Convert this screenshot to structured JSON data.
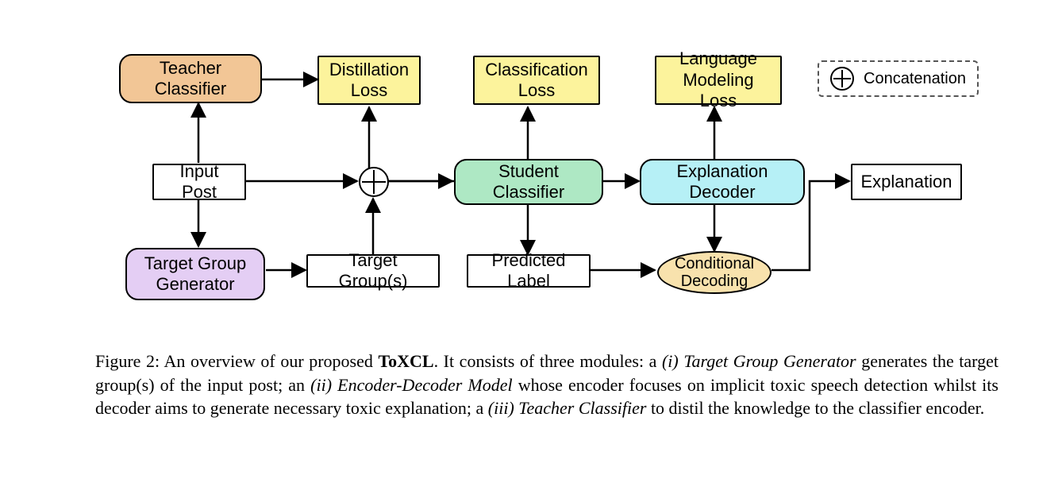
{
  "nodes": {
    "teacher": "Teacher Classifier",
    "distill_loss": "Distillation Loss",
    "class_loss": "Classification Loss",
    "lm_loss": "Language Modeling Loss",
    "input_post": "Input Post",
    "student": "Student Classifier",
    "decoder": "Explanation Decoder",
    "explanation": "Explanation",
    "tg_generator": "Target Group Generator",
    "target_groups": "Target Group(s)",
    "predicted_label": "Predicted Label",
    "conditional_decoding": "Conditional Decoding"
  },
  "legend": {
    "concat_label": "Concatenation"
  },
  "caption": {
    "prefix": "Figure 2:",
    "lead": " An overview of our proposed ",
    "model_name": "ToXCL",
    "after_model": ". It consists of three modules: a ",
    "i_label": "(i) Target Group Generator",
    "i_text": " generates the target group(s) of the input post; an ",
    "ii_label": "(ii) Encoder-Decoder Model",
    "ii_text": " whose encoder focuses on implicit toxic speech detection whilst its decoder aims to generate necessary toxic explanation; a ",
    "iii_label": "(iii) Teacher Classifier",
    "iii_text": " to distil the knowledge to the classifier encoder."
  }
}
